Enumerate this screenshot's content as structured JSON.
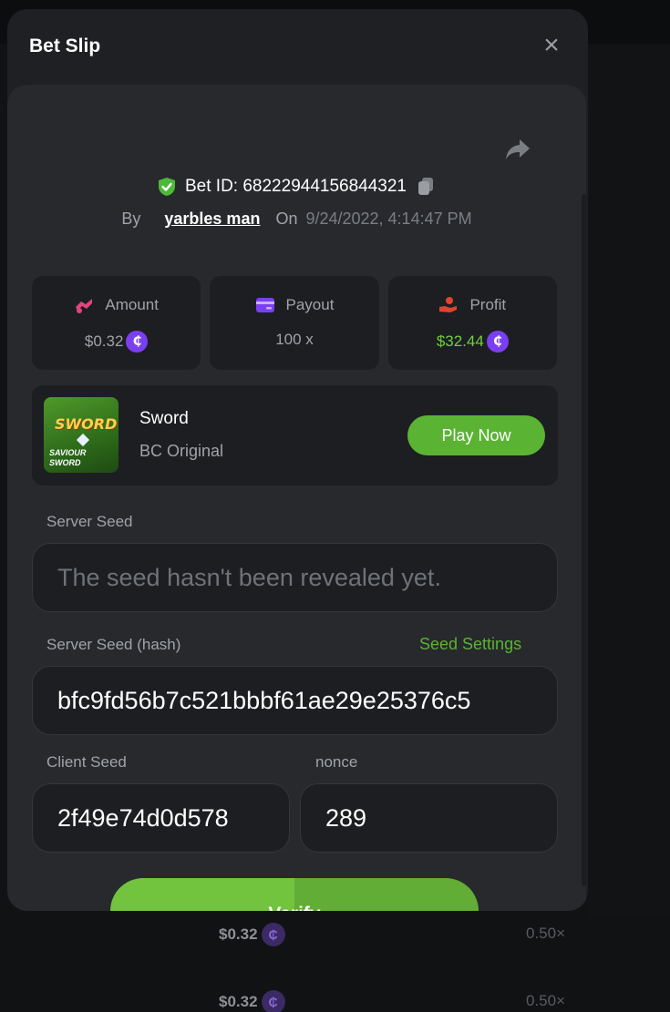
{
  "background": {
    "rows": [
      {
        "amount": "$0.32",
        "coin": "₵",
        "multiplier": "0.50×"
      },
      {
        "amount": "$0.32",
        "coin": "₵",
        "multiplier": "0.50×"
      }
    ]
  },
  "modal": {
    "title": "Bet Slip",
    "close_symbol": "×",
    "bet_id_label": "Bet ID:",
    "bet_id": "68222944156844321",
    "by_label": "By",
    "username": "yarbles man",
    "on_label": "On",
    "date": "9/24/2022, 4:14:47 PM",
    "stats": [
      {
        "label": "Amount",
        "value": "$0.32",
        "icon": "amount-icon",
        "icon_color": "#e0457b",
        "has_coin": true,
        "value_color": "#a0a3a8"
      },
      {
        "label": "Payout",
        "value": "100 x",
        "icon": "card-icon",
        "icon_color": "#7b3ff2",
        "has_coin": false,
        "value_color": "#a0a3a8"
      },
      {
        "label": "Profit",
        "value": "$32.44",
        "icon": "profit-hand-icon",
        "icon_color": "#e0452b",
        "has_coin": true,
        "value_color": "#6fd03d"
      }
    ],
    "coin_symbol": "₵",
    "game": {
      "name": "Sword",
      "provider": "BC Original",
      "thumb_title": "SWORD",
      "thumb_subtitle": "SAVIOUR SWORD",
      "play_label": "Play Now"
    },
    "server_seed": {
      "label": "Server Seed",
      "placeholder": "The seed hasn't been revealed yet."
    },
    "server_seed_hash": {
      "label": "Server Seed (hash)",
      "link": "Seed Settings",
      "value": "bfc9fd56b7c521bbbf61ae29e25376c5"
    },
    "client_seed": {
      "label": "Client Seed",
      "value": "2f49e74d0d578"
    },
    "nonce": {
      "label": "nonce",
      "value": "289"
    },
    "verify_label": "Verify"
  },
  "colors": {
    "accent_green": "#5bb334",
    "coin_purple": "#7b3ff2",
    "modal_bg": "#1f2023",
    "panel_bg": "#27292d"
  }
}
